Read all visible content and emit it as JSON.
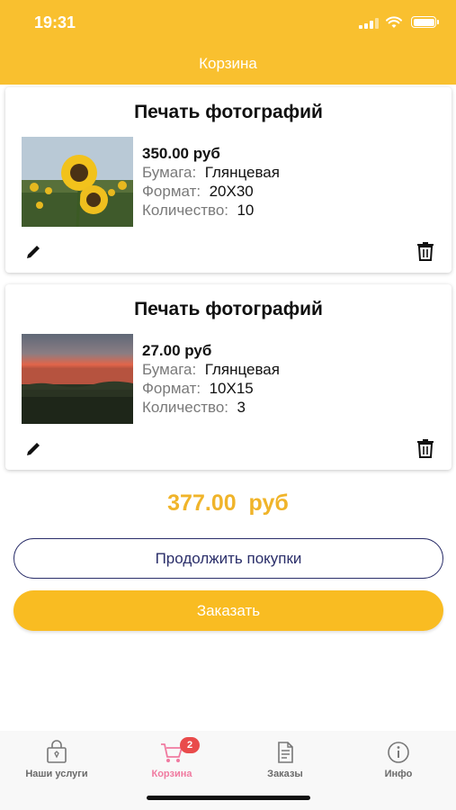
{
  "status_bar": {
    "time": "19:31"
  },
  "header": {
    "title": "Корзина"
  },
  "cart_items": [
    {
      "title": "Печать фотографий",
      "image": "sunflowers-photo",
      "price": "350.00 руб",
      "paper_label": "Бумага:",
      "paper_value": "Глянцевая",
      "format_label": "Формат:",
      "format_value": "20X30",
      "quantity_label": "Количество:",
      "quantity_value": "10",
      "edit_icon": "pencil-icon",
      "delete_icon": "trash-icon"
    },
    {
      "title": "Печать фотографий",
      "image": "sunset-field-photo",
      "price": "27.00 руб",
      "paper_label": "Бумага:",
      "paper_value": "Глянцевая",
      "format_label": "Формат:",
      "format_value": "10X15",
      "quantity_label": "Количество:",
      "quantity_value": "3",
      "edit_icon": "pencil-icon",
      "delete_icon": "trash-icon"
    }
  ],
  "total": {
    "amount": "377.00",
    "currency": "руб"
  },
  "buttons": {
    "continue_label": "Продолжить покупки",
    "order_label": "Заказать"
  },
  "tabbar": {
    "tabs": [
      {
        "label": "Наши услуги",
        "icon": "shopping-bag-icon",
        "active": false
      },
      {
        "label": "Корзина",
        "icon": "cart-icon",
        "active": true,
        "badge": "2"
      },
      {
        "label": "Заказы",
        "icon": "document-icon",
        "active": false
      },
      {
        "label": "Инфо",
        "icon": "info-icon",
        "active": false
      }
    ]
  },
  "colors": {
    "accent": "#f9c02f",
    "total": "#f0b42a",
    "button_outline": "#2b2f6a",
    "active_tab": "#f07aa0",
    "badge": "#e94b4b"
  }
}
